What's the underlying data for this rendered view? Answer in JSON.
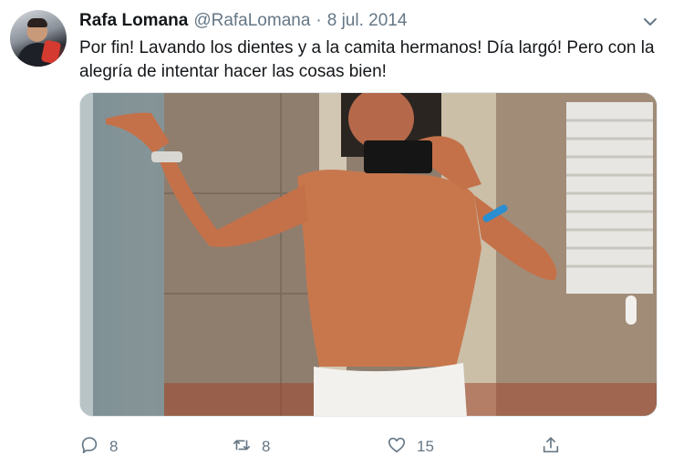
{
  "tweet": {
    "author_name": "Rafa Lomana",
    "handle": "@RafaLomana",
    "separator": "·",
    "date": "8 jul. 2014",
    "text": "Por fin! Lavando los dientes y a la camita hermanos! Día largó! Pero con la alegría de intentar hacer las cosas bien!"
  },
  "actions": {
    "reply_count": "8",
    "retweet_count": "8",
    "like_count": "15"
  },
  "icons": {
    "more": "chevron-down-icon",
    "reply": "reply-icon",
    "retweet": "retweet-icon",
    "like": "heart-icon",
    "share": "share-icon"
  },
  "colors": {
    "text": "#14171a",
    "secondary": "#657786"
  }
}
